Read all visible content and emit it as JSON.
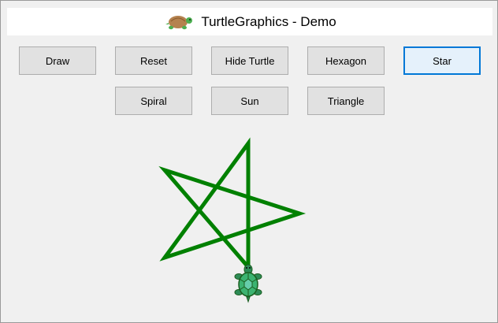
{
  "window": {
    "title": "TurtleGraphics - Demo",
    "icon": "turtle-icon"
  },
  "toolbar": {
    "row1": [
      "Draw",
      "Reset",
      "Hide Turtle",
      "Hexagon",
      "Star"
    ],
    "row2": [
      "Spiral",
      "Sun",
      "Triangle"
    ],
    "focused_button": "Star"
  },
  "canvas": {
    "shape": "star",
    "pen_color": "#008000",
    "turtle_icon": "turtle-icon",
    "turtle_color": "#3cb371"
  }
}
